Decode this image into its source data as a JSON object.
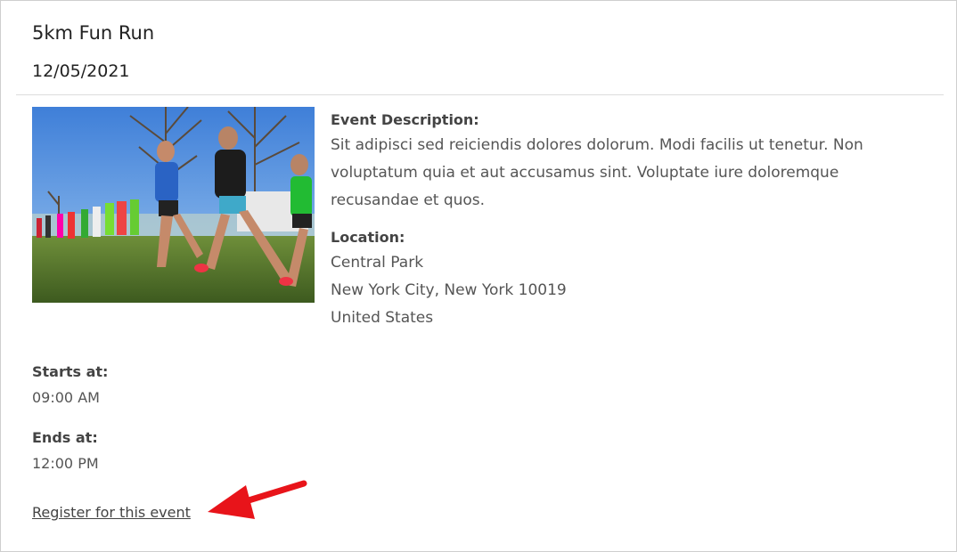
{
  "event": {
    "title": "5km Fun Run",
    "date": "12/05/2021",
    "description_label": "Event Description:",
    "description": "Sit adipisci sed reiciendis dolores dolorum. Modi facilis ut tenetur. Non voluptatum quia et aut accusamus sint. Voluptate iure doloremque recusandae et quos.",
    "location_label": "Location:",
    "location": {
      "venue": "Central Park",
      "city_line": "New York City, New York 10019",
      "country": "United States"
    },
    "starts_label": "Starts at:",
    "starts_time": "09:00 AM",
    "ends_label": "Ends at:",
    "ends_time": "12:00 PM",
    "register_link": "Register for this event",
    "image_icon": "runners-photo"
  },
  "colors": {
    "arrow": "#e8141a",
    "link": "#444444",
    "divider": "#dddddd"
  }
}
